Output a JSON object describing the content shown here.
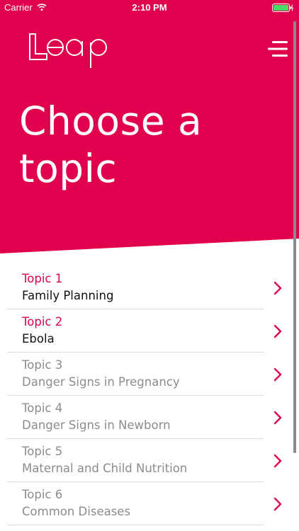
{
  "colors": {
    "brand": "#e0004d",
    "active_text": "#111111",
    "inactive_text": "#8c8c8c",
    "divider": "#dcdcdc"
  },
  "status_bar": {
    "carrier": "Carrier",
    "time": "2:10 PM",
    "icons": [
      "wifi-icon",
      "battery-icon"
    ]
  },
  "header": {
    "logo_text": "Leap",
    "menu_icon": "hamburger-menu-icon",
    "title": "Choose a topic"
  },
  "topics": [
    {
      "number": "Topic 1",
      "name": "Family Planning",
      "state": "active"
    },
    {
      "number": "Topic 2",
      "name": "Ebola",
      "state": "active"
    },
    {
      "number": "Topic 3",
      "name": "Danger Signs in Pregnancy",
      "state": "inactive"
    },
    {
      "number": "Topic 4",
      "name": "Danger Signs in Newborn",
      "state": "inactive"
    },
    {
      "number": "Topic 5",
      "name": "Maternal and Child Nutrition",
      "state": "inactive"
    },
    {
      "number": "Topic 6",
      "name": "Common Diseases",
      "state": "inactive"
    }
  ]
}
